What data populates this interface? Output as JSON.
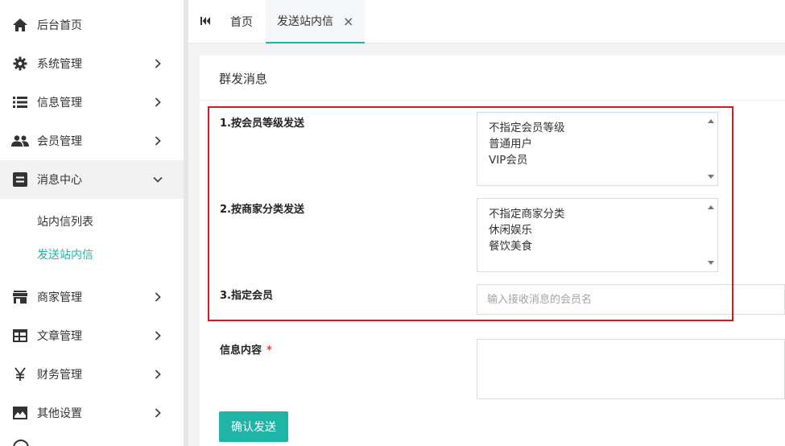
{
  "sidebar": {
    "items": [
      {
        "label": "后台首页",
        "icon": "home-icon",
        "has_chevron": false
      },
      {
        "label": "系统管理",
        "icon": "gear-icon",
        "has_chevron": true
      },
      {
        "label": "信息管理",
        "icon": "list-icon",
        "has_chevron": true
      },
      {
        "label": "会员管理",
        "icon": "users-icon",
        "has_chevron": true
      },
      {
        "label": "消息中心",
        "icon": "message-icon",
        "has_chevron": true,
        "expanded": true
      },
      {
        "label": "商家管理",
        "icon": "store-icon",
        "has_chevron": true
      },
      {
        "label": "文章管理",
        "icon": "article-icon",
        "has_chevron": true
      },
      {
        "label": "财务管理",
        "icon": "yen-icon",
        "has_chevron": true
      },
      {
        "label": "其他设置",
        "icon": "image-icon",
        "has_chevron": true
      }
    ],
    "subitems": [
      {
        "label": "站内信列表",
        "active": false
      },
      {
        "label": "发送站内信",
        "active": true
      }
    ]
  },
  "tabs": {
    "items": [
      {
        "label": "首页",
        "active": false
      },
      {
        "label": "发送站内信",
        "active": true,
        "closable": true
      }
    ],
    "close_glyph": "×"
  },
  "card": {
    "title": "群发消息"
  },
  "form": {
    "member_level": {
      "label": "1.按会员等级发送",
      "options": [
        "不指定会员等级",
        "普通用户",
        "VIP会员"
      ]
    },
    "merchant_category": {
      "label": "2.按商家分类发送",
      "options": [
        "不指定商家分类",
        "休闲娱乐",
        "餐饮美食"
      ]
    },
    "specific_member": {
      "label": "3.指定会员",
      "placeholder": "输入接收消息的会员名",
      "value": ""
    },
    "content": {
      "label": "信息内容",
      "required_mark": "*",
      "value": ""
    },
    "submit_label": "确认发送"
  },
  "colors": {
    "accent": "#1fb5a6",
    "highlight": "#e0141b",
    "required": "#e53935"
  }
}
